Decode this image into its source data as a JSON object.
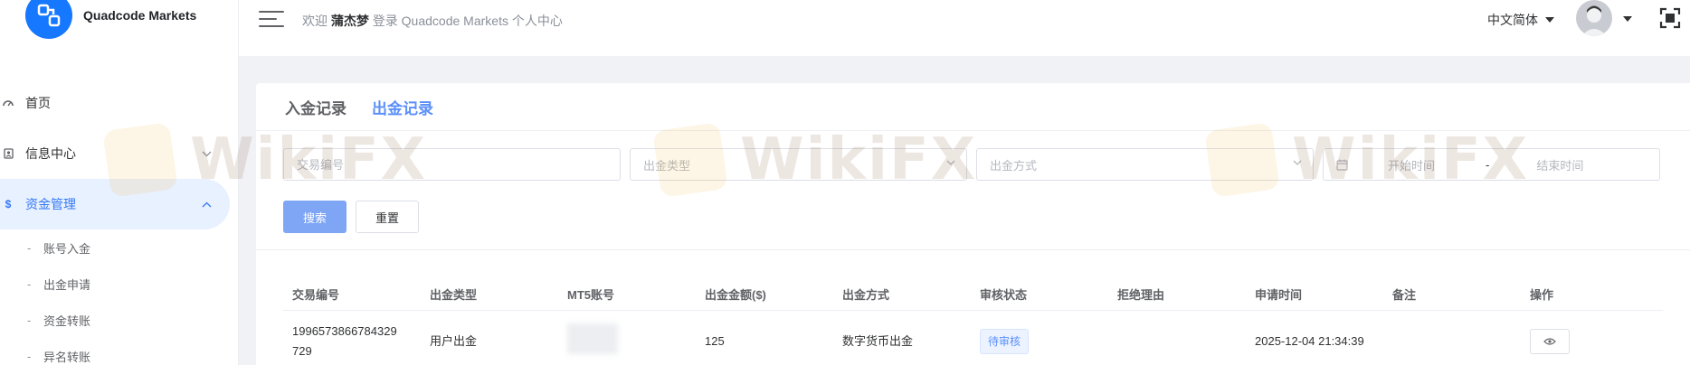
{
  "brand": {
    "name": "Quadcode Markets"
  },
  "sidebar": {
    "items": [
      {
        "label": "首页",
        "icon": "dashboard-icon"
      },
      {
        "label": "信息中心",
        "icon": "id-card-icon"
      },
      {
        "label": "资金管理",
        "icon": "dollar-icon"
      }
    ],
    "subitems": [
      {
        "label": "账号入金"
      },
      {
        "label": "出金申请"
      },
      {
        "label": "资金转账"
      },
      {
        "label": "异名转账"
      }
    ]
  },
  "header": {
    "welcome_prefix": "欢迎",
    "username": "蒲杰梦",
    "welcome_suffix": "登录 Quadcode Markets 个人中心",
    "language": "中文简体"
  },
  "tabs": [
    {
      "label": "入金记录"
    },
    {
      "label": "出金记录"
    }
  ],
  "filters": {
    "transaction_no_placeholder": "交易编号",
    "withdraw_type_placeholder": "出金类型",
    "withdraw_method_placeholder": "出金方式",
    "start_date_placeholder": "开始时间",
    "date_separator": "-",
    "end_date_placeholder": "结束时间"
  },
  "buttons": {
    "search": "搜索",
    "reset": "重置"
  },
  "table": {
    "headers": [
      "交易编号",
      "出金类型",
      "MT5账号",
      "出金金额($)",
      "出金方式",
      "审核状态",
      "拒绝理由",
      "申请时间",
      "备注",
      "操作"
    ],
    "rows": [
      {
        "transaction_no": "1996573866784329729",
        "withdraw_type": "用户出金",
        "mt5_account": "",
        "amount": "125",
        "method": "数字货币出金",
        "status": "待审核",
        "reject_reason": "",
        "apply_time": "2025-12-04 21:34:39",
        "remark": ""
      }
    ]
  },
  "watermark": {
    "text": "WikiFX"
  },
  "colors": {
    "accent": "#5b8ff9",
    "primary_button": "#7ea6f5",
    "active_menu_bg": "#e8f1ff"
  }
}
